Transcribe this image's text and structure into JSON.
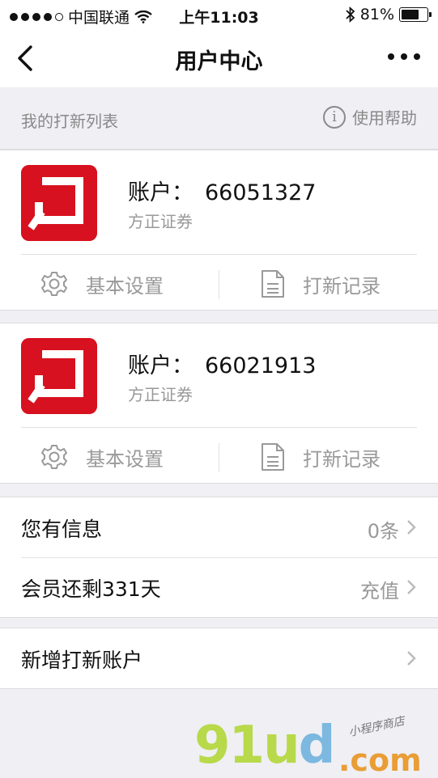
{
  "status": {
    "carrier": "中国联通",
    "time": "上午11:03",
    "battery": "81%",
    "battery_level": 0.81
  },
  "nav": {
    "title": "用户中心",
    "back_icon": "chevron-left-icon",
    "more_icon": "more-dots-icon"
  },
  "section": {
    "label": "我的打新列表",
    "help": "使用帮助"
  },
  "accounts": [
    {
      "label": "账户：",
      "number": "66051327",
      "broker": "方正证券",
      "settings": "基本设置",
      "records": "打新记录"
    },
    {
      "label": "账户：",
      "number": "66021913",
      "broker": "方正证券",
      "settings": "基本设置",
      "records": "打新记录"
    }
  ],
  "list": {
    "messages": {
      "label": "您有信息",
      "value": "0条"
    },
    "membership": {
      "label": "会员还剩331天",
      "value": "充值"
    },
    "add": {
      "label": "新增打新账户"
    }
  },
  "watermark": {
    "main_a": "91u",
    "main_b": "d",
    "com": ".com",
    "small": "小程序商店"
  },
  "colors": {
    "brand_red": "#d7111f",
    "background": "#efeff4",
    "muted_text": "#999999"
  }
}
